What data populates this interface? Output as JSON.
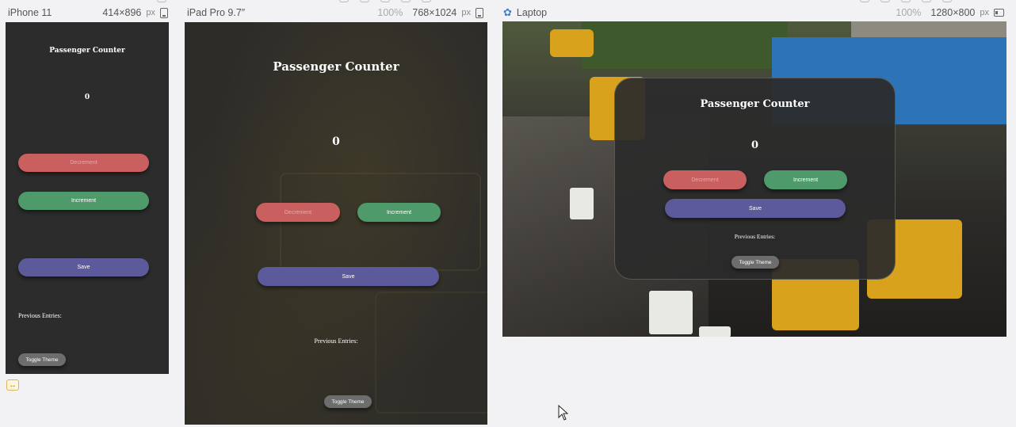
{
  "devices": [
    {
      "name": "iPhone 11",
      "width": "414",
      "height": "896",
      "unit": "px"
    },
    {
      "name": "iPad Pro 9.7″",
      "zoom": "100%",
      "width": "768",
      "height": "1024",
      "unit": "px"
    },
    {
      "name": "Laptop",
      "zoom": "100%",
      "width": "1280",
      "height": "800",
      "unit": "px"
    }
  ],
  "times": "×",
  "app": {
    "title": "Passenger Counter",
    "count": "0",
    "decrement_label": "Decrement",
    "increment_label": "Increment",
    "save_label": "Save",
    "previous_entries_label": "Previous Entries:",
    "toggle_theme_label": "Toggle Theme"
  },
  "colors": {
    "decrement": "#c95f5f",
    "increment": "#4e9a6b",
    "save": "#5d5a9c",
    "toggle": "#6d6d6d",
    "app_background": "#2c2c2c"
  }
}
